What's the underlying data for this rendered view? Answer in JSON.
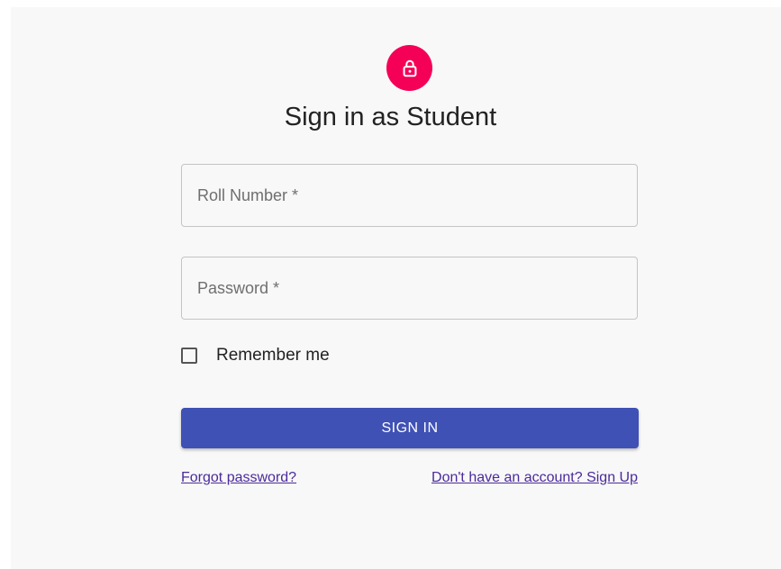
{
  "colors": {
    "avatar_bg": "#f50057",
    "button_bg": "#3f51b5",
    "link": "#4b2a9b",
    "page_bg": "#f8f8f8"
  },
  "icon": "lock-icon",
  "title": "Sign in as Student",
  "fields": {
    "roll_number": {
      "placeholder": "Roll Number *",
      "value": ""
    },
    "password": {
      "placeholder": "Password *",
      "value": ""
    }
  },
  "remember": {
    "label": "Remember me",
    "checked": false
  },
  "button": {
    "label": "SIGN IN"
  },
  "links": {
    "forgot": "Forgot password?",
    "signup": "Don't have an account? Sign Up"
  }
}
